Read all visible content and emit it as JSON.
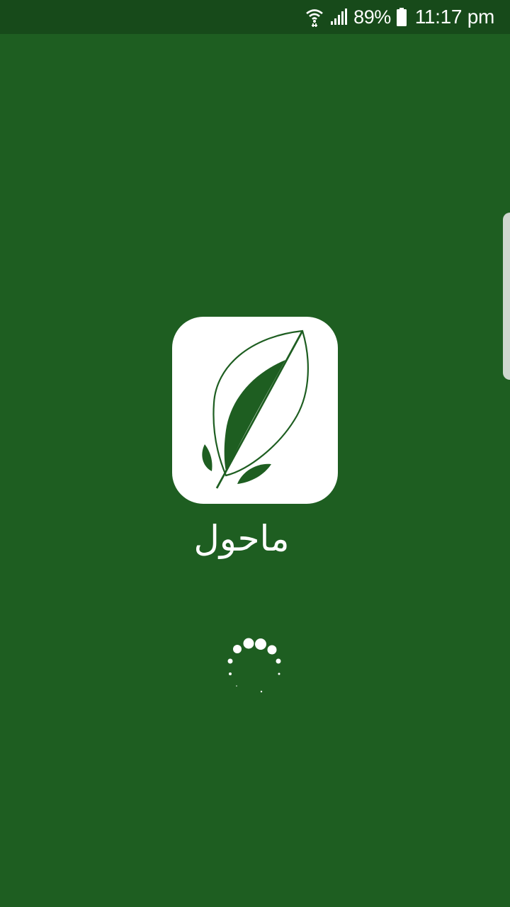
{
  "status_bar": {
    "wifi_icon": "wifi-calling-icon",
    "signal_icon": "cell-signal-icon",
    "battery_percent": "89%",
    "battery_icon": "battery-icon",
    "time": "11:17 pm"
  },
  "splash": {
    "logo_icon": "leaf-icon",
    "app_name": "ماحول",
    "loading_icon": "dotted-spinner-icon"
  },
  "colors": {
    "background": "#1e5e21",
    "status_bar": "#174a1a",
    "logo_tile": "#ffffff",
    "text": "#ffffff"
  }
}
